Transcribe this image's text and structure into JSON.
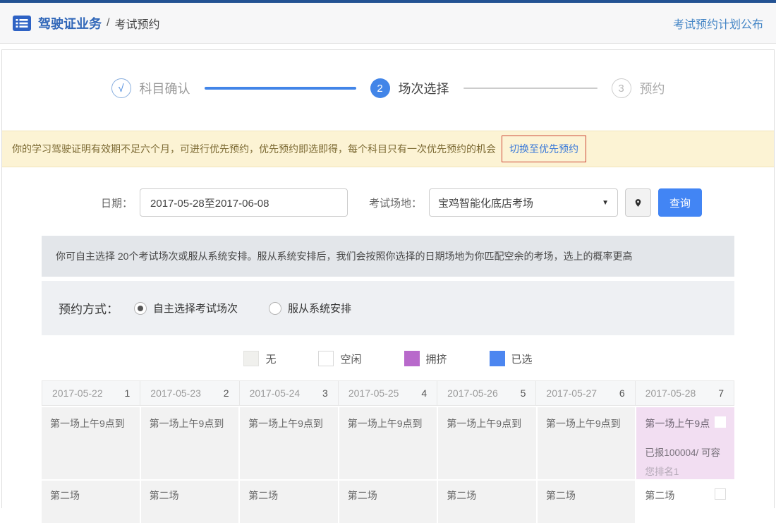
{
  "colors": {
    "primary_blue": "#4285f4",
    "link_blue": "#3b7ad9",
    "top_strip": "#235293",
    "notice_bg": "#fcf3d4",
    "annotation_red": "#cd4636",
    "crowded_purple": "#b869cb",
    "selected_blue": "#4c86f0",
    "crowded_cell_bg": "#f2def2"
  },
  "header": {
    "breadcrumb": {
      "primary": "驾驶证业务",
      "separator": "/",
      "secondary": "考试预约"
    },
    "plan_link": "考试预约计划公布"
  },
  "steps": [
    {
      "marker": "√",
      "label": "科目确认",
      "state": "done"
    },
    {
      "marker": "2",
      "label": "场次选择",
      "state": "active"
    },
    {
      "marker": "3",
      "label": "预约",
      "state": "pending"
    }
  ],
  "notice": {
    "text": "你的学习驾驶证明有效期不足六个月，可进行优先预约，优先预约即选即得，每个科目只有一次优先预约的机会",
    "link": "切换至优先预约"
  },
  "filters": {
    "date_label": "日期：",
    "date_value": "2017-05-28至2017-06-08",
    "venue_label": "考试场地：",
    "venue_value": "宝鸡智能化底店考场",
    "dropdown_glyph": "▼",
    "search_button": "查询"
  },
  "tips": "你可自主选择 20个考试场次或服从系统安排。服从系统安排后，我们会按照你选择的日期场地为你匹配空余的考场，选上的概率更高",
  "booking_mode": {
    "label": "预约方式：",
    "options": [
      {
        "label": "自主选择考试场次",
        "selected": true
      },
      {
        "label": "服从系统安排",
        "selected": false
      }
    ]
  },
  "legend": [
    {
      "label": "无",
      "color": "#f0f0ed"
    },
    {
      "label": "空闲",
      "color": "#ffffff"
    },
    {
      "label": "拥挤",
      "color": "#b869cb"
    },
    {
      "label": "已选",
      "color": "#4c86f0"
    }
  ],
  "schedule": {
    "columns": [
      {
        "date": "2017-05-22",
        "day_num": "1"
      },
      {
        "date": "2017-05-23",
        "day_num": "2"
      },
      {
        "date": "2017-05-24",
        "day_num": "3"
      },
      {
        "date": "2017-05-25",
        "day_num": "4"
      },
      {
        "date": "2017-05-26",
        "day_num": "5"
      },
      {
        "date": "2017-05-27",
        "day_num": "6"
      },
      {
        "date": "2017-05-28",
        "day_num": "7"
      }
    ],
    "rows": [
      {
        "label": "第一场上午9点到"
      },
      {
        "label": "第二场"
      }
    ],
    "selected_cell": {
      "label": "第一场上午9点",
      "enrolled": "已报100004/ 可容",
      "rank": "您排名1"
    }
  }
}
